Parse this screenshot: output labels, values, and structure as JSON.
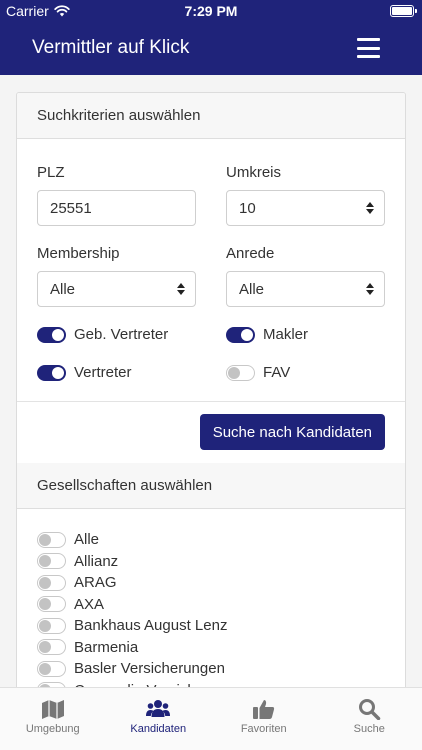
{
  "status": {
    "carrier": "Carrier",
    "time": "7:29 PM"
  },
  "header": {
    "title": "Vermittler auf Klick"
  },
  "criteria": {
    "title": "Suchkriterien auswählen",
    "plz_label": "PLZ",
    "plz_value": "25551",
    "radius_label": "Umkreis",
    "radius_value": "10",
    "membership_label": "Membership",
    "membership_value": "Alle",
    "salutation_label": "Anrede",
    "salutation_value": "Alle",
    "toggles": [
      {
        "label": "Geb. Vertreter",
        "on": true
      },
      {
        "label": "Makler",
        "on": true
      },
      {
        "label": "Vertreter",
        "on": true
      },
      {
        "label": "FAV",
        "on": false
      }
    ],
    "search_button": "Suche nach Kandidaten"
  },
  "companies": {
    "title": "Gesellschaften auswählen",
    "items": [
      {
        "label": "Alle",
        "on": false
      },
      {
        "label": "Allianz",
        "on": false
      },
      {
        "label": "ARAG",
        "on": false
      },
      {
        "label": "AXA",
        "on": false
      },
      {
        "label": "Bankhaus August Lenz",
        "on": false
      },
      {
        "label": "Barmenia",
        "on": false
      },
      {
        "label": "Basler Versicherungen",
        "on": false
      },
      {
        "label": "Concordia Versicherungen",
        "on": false
      }
    ]
  },
  "tabs": [
    {
      "label": "Umgebung",
      "icon": "map-icon",
      "active": false
    },
    {
      "label": "Kandidaten",
      "icon": "users-icon",
      "active": true
    },
    {
      "label": "Favoriten",
      "icon": "thumbs-up-icon",
      "active": false
    },
    {
      "label": "Suche",
      "icon": "search-icon",
      "active": false
    }
  ],
  "colors": {
    "primary": "#1f237a",
    "background": "#f4f4f4",
    "inactive_tab": "#777777"
  }
}
